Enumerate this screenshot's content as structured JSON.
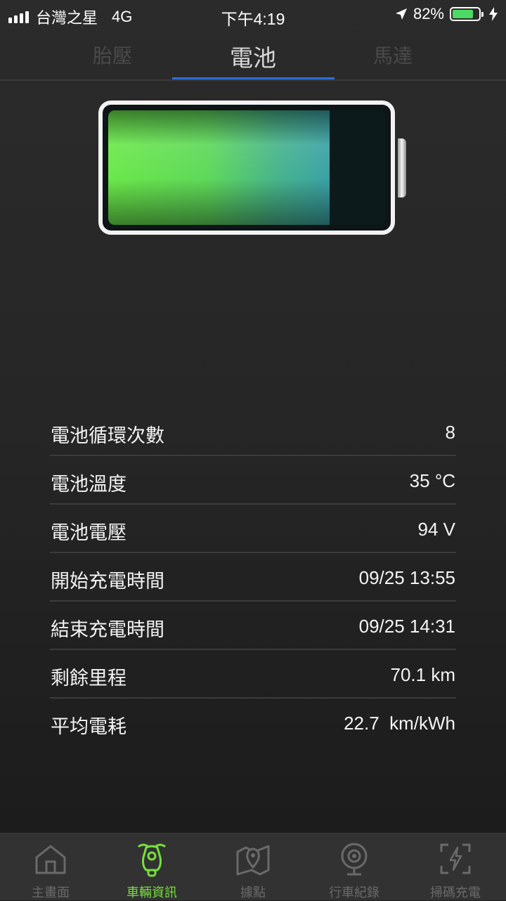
{
  "status_bar": {
    "carrier": "台灣之星",
    "network": "4G",
    "time": "下午4:19",
    "battery_percent_label": "82%",
    "battery_level": 0.82,
    "icons": [
      "signal-icon",
      "location-arrow-icon",
      "battery-icon",
      "charging-bolt-icon"
    ]
  },
  "tabs": [
    {
      "label": "胎壓",
      "active": false
    },
    {
      "label": "電池",
      "active": true
    },
    {
      "label": "馬達",
      "active": false
    }
  ],
  "battery_graphic": {
    "charge_level": 0.8,
    "gradient_colors": [
      "#6be84a",
      "#3aa1a6"
    ]
  },
  "info_rows": [
    {
      "label": "電池循環次數",
      "value": "8"
    },
    {
      "label": "電池溫度",
      "value": "35 °C"
    },
    {
      "label": "電池電壓",
      "value": "94 V"
    },
    {
      "label": "開始充電時間",
      "value": "09/25 13:55"
    },
    {
      "label": "結束充電時間",
      "value": "09/25 14:31"
    },
    {
      "label": "剩餘里程",
      "value": "70.1 km"
    },
    {
      "label": "平均電耗",
      "value": "22.7  km/kWh"
    }
  ],
  "bottom_nav": [
    {
      "label": "主畫面",
      "icon": "home-icon",
      "active": false
    },
    {
      "label": "車輛資訊",
      "icon": "scooter-icon",
      "active": true
    },
    {
      "label": "據點",
      "icon": "map-pin-icon",
      "active": false
    },
    {
      "label": "行車紀錄",
      "icon": "dashcam-icon",
      "active": false
    },
    {
      "label": "掃碼充電",
      "icon": "scan-charge-icon",
      "active": false
    }
  ],
  "colors": {
    "accent_blue": "#2f6fd8",
    "active_green": "#76e03c",
    "background": "#262626"
  }
}
